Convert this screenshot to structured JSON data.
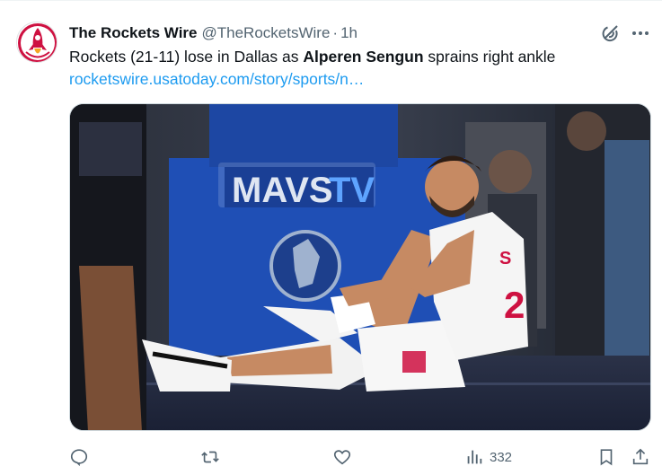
{
  "tweet": {
    "display_name": "The Rockets Wire",
    "handle": "@TheRocketsWire",
    "separator": "·",
    "time": "1h",
    "text_before": "Rockets (21-11) lose in Dallas as ",
    "text_bold": "Alperen Sengun",
    "text_after": " sprains right ankle",
    "link": "rocketswire.usatoday.com/story/sports/n…",
    "media": {
      "sign_left": "MAVS",
      "sign_right": "TV",
      "jersey_letter": "S",
      "jersey_number": "2"
    }
  },
  "icons": {
    "avatar": "rocket-logo-icon",
    "grok": "grok-icon",
    "more": "more-dots-icon",
    "reply": "reply-icon",
    "retweet": "retweet-icon",
    "like": "heart-icon",
    "views": "views-bar-chart-icon",
    "bookmark": "bookmark-icon",
    "share": "share-icon"
  },
  "stats": {
    "views": "332"
  },
  "colors": {
    "link": "#1d9bf0",
    "secondary_text": "#536471",
    "brand_red": "#ce1141"
  }
}
